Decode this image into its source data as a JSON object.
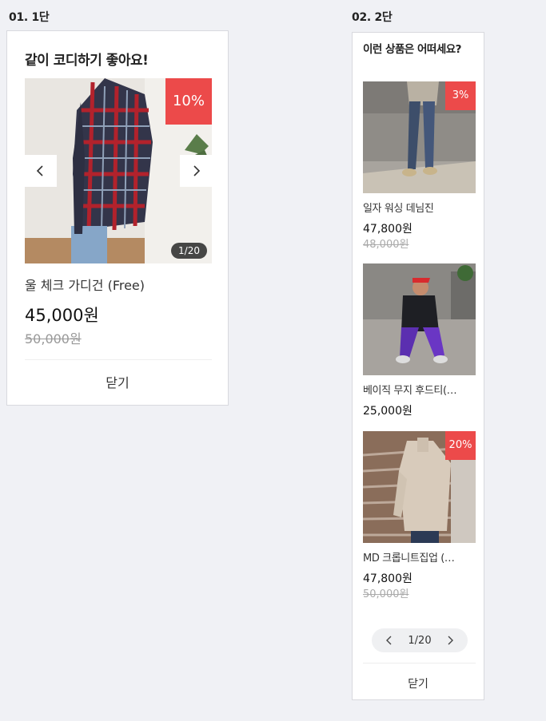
{
  "section1": {
    "label": "01. 1단"
  },
  "section2": {
    "label": "02. 2단"
  },
  "card1": {
    "title": "같이 코디하기 좋아요!",
    "discount": "10%",
    "counter": "1/20",
    "product_name": "울 체크 가디건 (Free)",
    "price": "45,000원",
    "original_price": "50,000원",
    "close_label": "닫기"
  },
  "card2": {
    "title": "이런 상품은 어떠세요?",
    "products": [
      {
        "discount": "3%",
        "name": "일자 워싱 데님진",
        "price": "47,800원",
        "original_price": "48,000원"
      },
      {
        "discount": "",
        "name": "베이직 무지 후드티(…",
        "price": "25,000원",
        "original_price": ""
      },
      {
        "discount": "20%",
        "name": "MD 크롭니트집업 (…",
        "price": "47,800원",
        "original_price": "50,000원"
      }
    ],
    "pager": "1/20",
    "close_label": "닫기"
  },
  "colors": {
    "accent_discount": "#ec4a4a",
    "background": "#f0f1f5"
  },
  "icons": {
    "prev": "chevron-left-icon",
    "next": "chevron-right-icon"
  }
}
